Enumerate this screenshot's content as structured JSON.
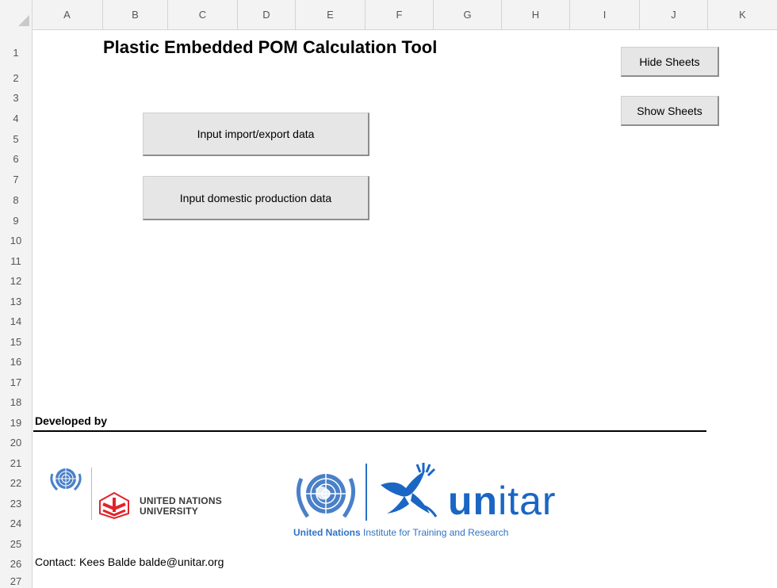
{
  "spreadsheet": {
    "columns": [
      "A",
      "B",
      "C",
      "D",
      "E",
      "F",
      "G",
      "H",
      "I",
      "J",
      "K"
    ],
    "rows": [
      "1",
      "2",
      "3",
      "4",
      "5",
      "6",
      "7",
      "8",
      "9",
      "10",
      "11",
      "12",
      "13",
      "14",
      "15",
      "16",
      "17",
      "18",
      "19",
      "20",
      "21",
      "22",
      "23",
      "24",
      "25",
      "26",
      "27"
    ]
  },
  "title": "Plastic Embedded POM Calculation Tool",
  "buttons": {
    "hide_sheets": "Hide Sheets",
    "show_sheets": "Show Sheets",
    "input_import_export": "Input import/export data",
    "input_domestic": "Input domestic production data"
  },
  "developed_by": "Developed by",
  "logos": {
    "unu_line1": "UNITED NATIONS",
    "unu_line2": "UNIVERSITY",
    "unitar_word_bold": "un",
    "unitar_word_light": "itar",
    "unitar_sub_bold": "United Nations",
    "unitar_sub_rest": " Institute for Training and Research",
    "unitar_color": "#1a66c4",
    "unu_mark_color": "#e2232a"
  },
  "contact": "Contact: Kees Balde balde@unitar.org"
}
